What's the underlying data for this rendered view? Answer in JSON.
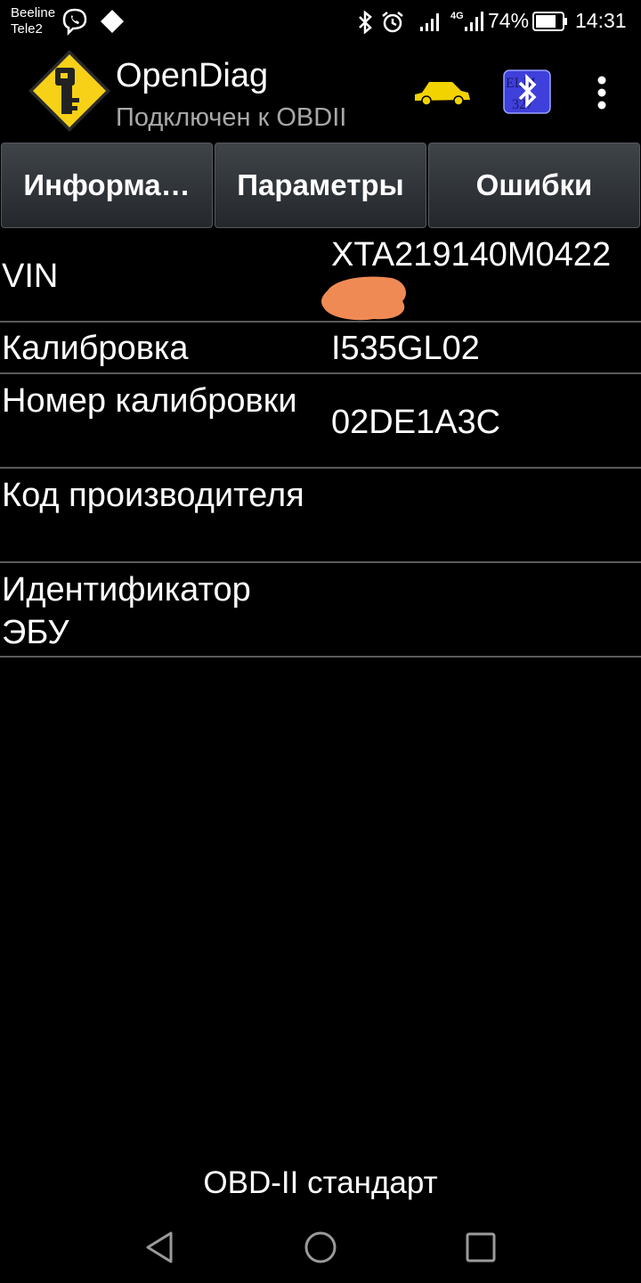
{
  "status_bar": {
    "carrier_1": "Beeline",
    "carrier_2": "Tele2",
    "battery": "74%",
    "time": "14:31",
    "icons": [
      "viber-icon",
      "diamond-icon",
      "bluetooth-icon",
      "alarm-icon",
      "signal-icon",
      "signal-4g-icon",
      "battery-icon"
    ]
  },
  "app_bar": {
    "title": "OpenDiag",
    "subtitle": "Подключен к OBDII",
    "logo_icon": "key-logo-icon",
    "car_icon": "car-icon",
    "adapter_icon": "bluetooth-adapter-icon",
    "menu_icon": "more-vertical-icon",
    "colors": {
      "car": "#f2d300",
      "logo": "#f7d117",
      "adapter": "#3f3fdb"
    }
  },
  "tabs": [
    {
      "label": "Информа…"
    },
    {
      "label": "Параметры"
    },
    {
      "label": "Ошибки"
    }
  ],
  "info_rows": [
    {
      "label": "VIN",
      "value": "XTA219140M0422"
    },
    {
      "label": "Калибровка",
      "value": "I535GL02"
    },
    {
      "label": "Номер калибровки",
      "value": "02DE1A3C"
    },
    {
      "label": "Код производителя",
      "value": ""
    },
    {
      "label": "Идентификатор ЭБУ",
      "value": ""
    }
  ],
  "footer": {
    "text": "OBD-II стандарт"
  },
  "nav_bar": {
    "back": "back-icon",
    "home": "home-icon",
    "recents": "recents-icon"
  }
}
